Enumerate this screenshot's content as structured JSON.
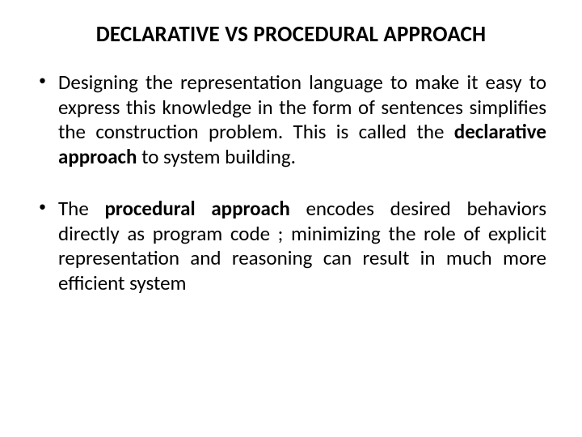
{
  "title": "DECLARATIVE VS PROCEDURAL APPROACH",
  "bullets": [
    {
      "pre": " Designing the representation language to make it easy to express this knowledge in the form of sentences simplifies the construction  problem. This is called the ",
      "bold": "declarative approach",
      "post": " to system building."
    },
    {
      "pre": " The ",
      "bold": "procedural approach",
      "post": " encodes desired behaviors directly as program code ; minimizing the role of explicit representation and reasoning can result in much more efficient system"
    }
  ]
}
